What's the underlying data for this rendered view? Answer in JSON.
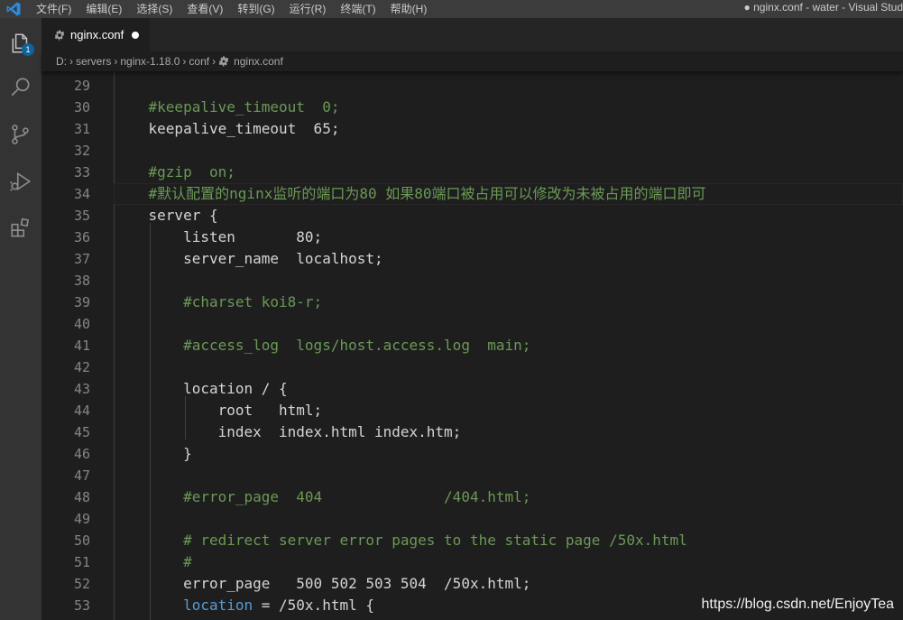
{
  "window": {
    "menu": [
      "文件(F)",
      "编辑(E)",
      "选择(S)",
      "查看(V)",
      "转到(G)",
      "运行(R)",
      "终端(T)",
      "帮助(H)"
    ],
    "title": "● nginx.conf - water - Visual Stud"
  },
  "activity_bar": {
    "items": [
      "explorer-icon",
      "search-icon",
      "source-control-icon",
      "run-debug-icon",
      "extensions-icon"
    ],
    "explorer_badge": "1"
  },
  "tab": {
    "label": "nginx.conf"
  },
  "breadcrumb": [
    "D:",
    "servers",
    "nginx-1.18.0",
    "conf",
    "nginx.conf"
  ],
  "editor": {
    "line_numbers": [
      "29",
      "30",
      "31",
      "32",
      "33",
      "34",
      "35",
      "36",
      "37",
      "38",
      "39",
      "40",
      "41",
      "42",
      "43",
      "44",
      "45",
      "46",
      "47",
      "48",
      "49",
      "50",
      "51",
      "52",
      "53"
    ],
    "lines": [
      [
        {
          "t": ""
        }
      ],
      [
        {
          "t": "    "
        },
        {
          "t": "#keepalive_timeout  0;",
          "c": "cmt"
        }
      ],
      [
        {
          "t": "    keepalive_timeout  65;"
        }
      ],
      [
        {
          "t": ""
        }
      ],
      [
        {
          "t": "    "
        },
        {
          "t": "#gzip  on;",
          "c": "cmt"
        }
      ],
      [
        {
          "t": "    "
        },
        {
          "t": "#默认配置的nginx监听的端口为80 如果80端口被占用可以修改为未被占用的端口即可",
          "c": "cmt"
        }
      ],
      [
        {
          "t": "    server {"
        }
      ],
      [
        {
          "t": "        listen       80;"
        }
      ],
      [
        {
          "t": "        server_name  localhost;"
        }
      ],
      [
        {
          "t": ""
        }
      ],
      [
        {
          "t": "        "
        },
        {
          "t": "#charset koi8-r;",
          "c": "cmt"
        }
      ],
      [
        {
          "t": ""
        }
      ],
      [
        {
          "t": "        "
        },
        {
          "t": "#access_log  logs/host.access.log  main;",
          "c": "cmt"
        }
      ],
      [
        {
          "t": ""
        }
      ],
      [
        {
          "t": "        location / {"
        }
      ],
      [
        {
          "t": "            root   html;"
        }
      ],
      [
        {
          "t": "            index  index.html index.htm;"
        }
      ],
      [
        {
          "t": "        }"
        }
      ],
      [
        {
          "t": ""
        }
      ],
      [
        {
          "t": "        "
        },
        {
          "t": "#error_page  404              /404.html;",
          "c": "cmt"
        }
      ],
      [
        {
          "t": ""
        }
      ],
      [
        {
          "t": "        "
        },
        {
          "t": "# redirect server error pages to the static page /50x.html",
          "c": "cmt"
        }
      ],
      [
        {
          "t": "        "
        },
        {
          "t": "#",
          "c": "cmt"
        }
      ],
      [
        {
          "t": "        error_page   500 502 503 504  /50x.html;"
        }
      ],
      [
        {
          "t": "        "
        },
        {
          "t": "location",
          "c": "kw"
        },
        {
          "t": " = /50x.html {"
        }
      ]
    ]
  },
  "watermark": "https://blog.csdn.net/EnjoyTea",
  "colors": {
    "comment": "#6a9955",
    "keyword": "#569cd6",
    "text": "#d4d4d4",
    "line_number": "#858585",
    "badge": "#0e639c"
  }
}
